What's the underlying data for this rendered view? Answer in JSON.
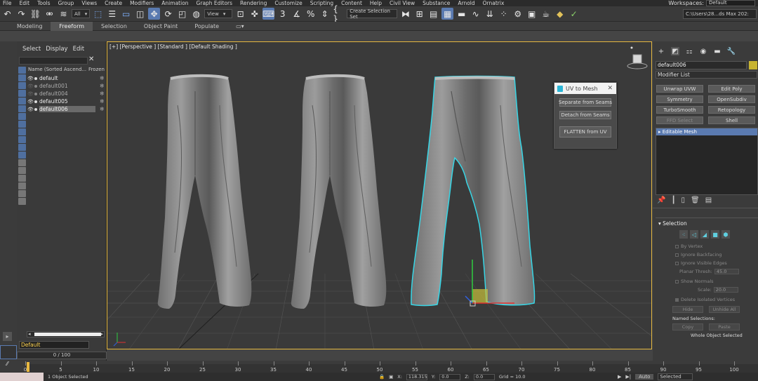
{
  "menu": [
    "File",
    "Edit",
    "Tools",
    "Group",
    "Views",
    "Create",
    "Modifiers",
    "Animation",
    "Graph Editors",
    "Rendering",
    "Customize",
    "Scripting",
    "Content",
    "Help",
    "Civil View",
    "Substance",
    "Arnold",
    "Ornatrix"
  ],
  "workspaces": {
    "label": "Workspaces:",
    "value": "Default"
  },
  "toolbar": {
    "filter_value": "All",
    "ref_coord": "View",
    "selection_set": "Create Selection Set",
    "path": "C:\\Users\\28...ds Max 202:"
  },
  "ribbon_tabs": [
    "Modeling",
    "Freeform",
    "Selection",
    "Object Paint",
    "Populate"
  ],
  "explorer": {
    "menu": [
      "Select",
      "Display",
      "Edit"
    ],
    "col_name": "Name (Sorted Ascend...",
    "col_frozen": "Frozen",
    "rows": [
      {
        "name": "default",
        "visible": true
      },
      {
        "name": "default001",
        "visible": false
      },
      {
        "name": "default004",
        "visible": false
      },
      {
        "name": "default005",
        "visible": true
      },
      {
        "name": "default006",
        "visible": true
      }
    ],
    "layer": "Default"
  },
  "viewport": {
    "label": "[+] [Perspective ] [Standard ] [Default Shading ]"
  },
  "uv_panel": {
    "title": "UV to Mesh",
    "buttons": [
      "Separate from Seams",
      "Detach from Seams",
      "FLATTEN from UV"
    ]
  },
  "command_panel": {
    "object_name": "default006",
    "object_color": "#c8b431",
    "modifier_list": "Modifier List",
    "buttons": [
      "Unwrap UVW",
      "Edit Poly",
      "Symmetry",
      "OpenSubdiv",
      "TurboSmooth",
      "Retopology",
      "FFD Select",
      "Shell"
    ],
    "stack_item": "Editable Mesh",
    "selection": {
      "title": "Selection",
      "by_vertex": "By Vertex",
      "ignore_backfacing": "Ignore Backfacing",
      "ignore_visible_edges": "Ignore Visible Edges",
      "planar_thresh_label": "Planar Thresh:",
      "planar_thresh_value": "45.0",
      "show_normals": "Show Normals",
      "scale_label": "Scale:",
      "scale_value": "20.0",
      "delete_isolated": "Delete Isolated Vertices",
      "hide": "Hide",
      "unhide_all": "Unhide All",
      "named_selections": "Named Selections:",
      "copy": "Copy",
      "paste": "Paste",
      "status": "Whole Object Selected"
    }
  },
  "timeline": {
    "slider": "0 / 100",
    "ticks": [
      0,
      5,
      10,
      15,
      20,
      25,
      30,
      35,
      40,
      45,
      50,
      55,
      60,
      65,
      70,
      75,
      80,
      85,
      90,
      95,
      100
    ]
  },
  "status": {
    "selected": "1 Object Selected",
    "x_label": "X:",
    "x": "118.315",
    "y_label": "Y:",
    "y": "0.0",
    "z_label": "Z:",
    "z": "0.0",
    "grid": "Grid = 10.0",
    "auto": "Auto",
    "selected_mode": "Selected"
  },
  "colors": {
    "accent": "#5a7ab0",
    "viewport_border": "#e5b840",
    "selection_outline": "#37d6e6"
  }
}
